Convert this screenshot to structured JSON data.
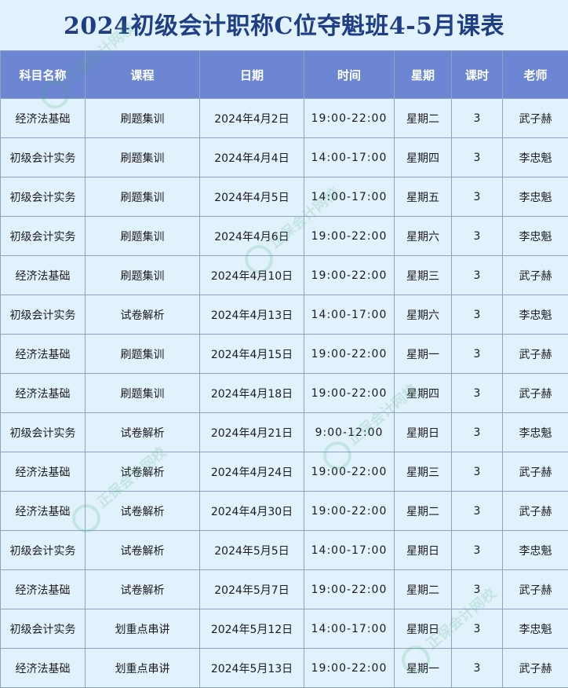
{
  "title": "2024初级会计职称C位夺魁班4-5月课表",
  "headers": {
    "subject": "科目名称",
    "course": "课程",
    "date": "日期",
    "time": "时间",
    "weekday": "星期",
    "hours": "课时",
    "teacher": "老师"
  },
  "rows": [
    {
      "subject": "经济法基础",
      "course": "刷题集训",
      "date": "2024年4月2日",
      "time": "19:00-22:00",
      "weekday": "星期二",
      "hours": "3",
      "teacher": "武子赫"
    },
    {
      "subject": "初级会计实务",
      "course": "刷题集训",
      "date": "2024年4月4日",
      "time": "14:00-17:00",
      "weekday": "星期四",
      "hours": "3",
      "teacher": "李忠魁"
    },
    {
      "subject": "初级会计实务",
      "course": "刷题集训",
      "date": "2024年4月5日",
      "time": "14:00-17:00",
      "weekday": "星期五",
      "hours": "3",
      "teacher": "李忠魁"
    },
    {
      "subject": "初级会计实务",
      "course": "刷题集训",
      "date": "2024年4月6日",
      "time": "19:00-22:00",
      "weekday": "星期六",
      "hours": "3",
      "teacher": "李忠魁"
    },
    {
      "subject": "经济法基础",
      "course": "刷题集训",
      "date": "2024年4月10日",
      "time": "19:00-22:00",
      "weekday": "星期三",
      "hours": "3",
      "teacher": "武子赫"
    },
    {
      "subject": "初级会计实务",
      "course": "试卷解析",
      "date": "2024年4月13日",
      "time": "14:00-17:00",
      "weekday": "星期六",
      "hours": "3",
      "teacher": "李忠魁"
    },
    {
      "subject": "经济法基础",
      "course": "刷题集训",
      "date": "2024年4月15日",
      "time": "19:00-22:00",
      "weekday": "星期一",
      "hours": "3",
      "teacher": "武子赫"
    },
    {
      "subject": "经济法基础",
      "course": "刷题集训",
      "date": "2024年4月18日",
      "time": "19:00-22:00",
      "weekday": "星期四",
      "hours": "3",
      "teacher": "武子赫"
    },
    {
      "subject": "初级会计实务",
      "course": "试卷解析",
      "date": "2024年4月21日",
      "time": "9:00-12:00",
      "weekday": "星期日",
      "hours": "3",
      "teacher": "李忠魁"
    },
    {
      "subject": "经济法基础",
      "course": "试卷解析",
      "date": "2024年4月24日",
      "time": "19:00-22:00",
      "weekday": "星期三",
      "hours": "3",
      "teacher": "武子赫"
    },
    {
      "subject": "经济法基础",
      "course": "试卷解析",
      "date": "2024年4月30日",
      "time": "19:00-22:00",
      "weekday": "星期二",
      "hours": "3",
      "teacher": "武子赫"
    },
    {
      "subject": "初级会计实务",
      "course": "试卷解析",
      "date": "2024年5月5日",
      "time": "14:00-17:00",
      "weekday": "星期日",
      "hours": "3",
      "teacher": "李忠魁"
    },
    {
      "subject": "经济法基础",
      "course": "试卷解析",
      "date": "2024年5月7日",
      "time": "19:00-22:00",
      "weekday": "星期二",
      "hours": "3",
      "teacher": "武子赫"
    },
    {
      "subject": "初级会计实务",
      "course": "划重点串讲",
      "date": "2024年5月12日",
      "time": "14:00-17:00",
      "weekday": "星期日",
      "hours": "3",
      "teacher": "李忠魁"
    },
    {
      "subject": "经济法基础",
      "course": "划重点串讲",
      "date": "2024年5月13日",
      "time": "19:00-22:00",
      "weekday": "星期一",
      "hours": "3",
      "teacher": "武子赫"
    }
  ],
  "watermark": {
    "text": "正保会计网校",
    "color": "#3cae6a"
  },
  "colors": {
    "background": "#e2f2fc",
    "header_bg": "#6c86d3",
    "title": "#1f3e86"
  }
}
